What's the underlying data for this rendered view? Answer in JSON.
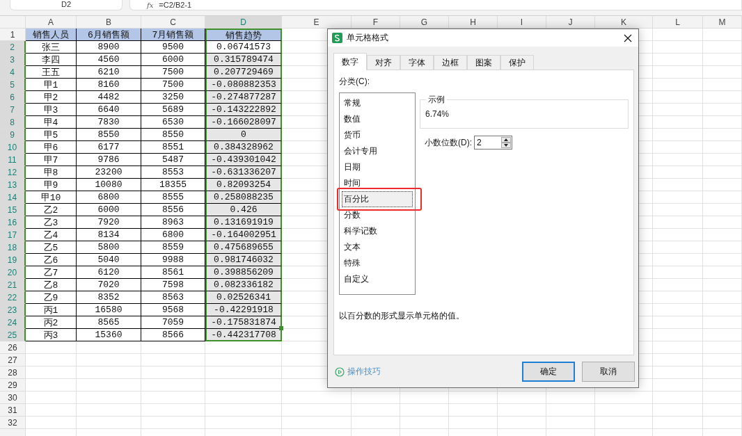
{
  "formula_bar": {
    "cell_name": "D2",
    "function_symbol": "fx",
    "formula": "=C2/B2-1"
  },
  "columns": [
    {
      "label": "A",
      "selected": false
    },
    {
      "label": "B",
      "selected": false
    },
    {
      "label": "C",
      "selected": false
    },
    {
      "label": "D",
      "selected": true
    },
    {
      "label": "E",
      "selected": false
    },
    {
      "label": "F",
      "selected": false
    },
    {
      "label": "G",
      "selected": false
    },
    {
      "label": "H",
      "selected": false
    },
    {
      "label": "I",
      "selected": false
    },
    {
      "label": "J",
      "selected": false
    },
    {
      "label": "K",
      "selected": false
    },
    {
      "label": "L",
      "selected": false
    },
    {
      "label": "M",
      "selected": false
    }
  ],
  "rows": [
    {
      "number": "1",
      "kind": "header",
      "selected": false,
      "active": false,
      "cells": [
        "销售人员",
        "6月销售额",
        "7月销售额",
        "销售趋势"
      ]
    },
    {
      "number": "2",
      "kind": "data",
      "selected": true,
      "active": true,
      "cells": [
        "张三",
        "8900",
        "9500",
        "0.06741573"
      ]
    },
    {
      "number": "3",
      "kind": "data",
      "selected": true,
      "active": false,
      "cells": [
        "李四",
        "4560",
        "6000",
        "0.315789474"
      ]
    },
    {
      "number": "4",
      "kind": "data",
      "selected": true,
      "active": false,
      "cells": [
        "王五",
        "6210",
        "7500",
        "0.207729469"
      ]
    },
    {
      "number": "5",
      "kind": "data",
      "selected": true,
      "active": false,
      "cells": [
        "甲1",
        "8160",
        "7500",
        "-0.080882353"
      ]
    },
    {
      "number": "6",
      "kind": "data",
      "selected": true,
      "active": false,
      "cells": [
        "甲2",
        "4482",
        "3250",
        "-0.274877287"
      ]
    },
    {
      "number": "7",
      "kind": "data",
      "selected": true,
      "active": false,
      "cells": [
        "甲3",
        "6640",
        "5689",
        "-0.143222892"
      ]
    },
    {
      "number": "8",
      "kind": "data",
      "selected": true,
      "active": false,
      "cells": [
        "甲4",
        "7830",
        "6530",
        "-0.166028097"
      ]
    },
    {
      "number": "9",
      "kind": "data",
      "selected": true,
      "active": false,
      "cells": [
        "甲5",
        "8550",
        "8550",
        "0"
      ]
    },
    {
      "number": "10",
      "kind": "data",
      "selected": true,
      "active": false,
      "cells": [
        "甲6",
        "6177",
        "8551",
        "0.384328962"
      ]
    },
    {
      "number": "11",
      "kind": "data",
      "selected": true,
      "active": false,
      "cells": [
        "甲7",
        "9786",
        "5487",
        "-0.439301042"
      ]
    },
    {
      "number": "12",
      "kind": "data",
      "selected": true,
      "active": false,
      "cells": [
        "甲8",
        "23200",
        "8553",
        "-0.631336207"
      ]
    },
    {
      "number": "13",
      "kind": "data",
      "selected": true,
      "active": false,
      "cells": [
        "甲9",
        "10080",
        "18355",
        "0.82093254"
      ]
    },
    {
      "number": "14",
      "kind": "data",
      "selected": true,
      "active": false,
      "cells": [
        "甲10",
        "6800",
        "8555",
        "0.258088235"
      ]
    },
    {
      "number": "15",
      "kind": "data",
      "selected": true,
      "active": false,
      "cells": [
        "乙2",
        "6000",
        "8556",
        "0.426"
      ]
    },
    {
      "number": "16",
      "kind": "data",
      "selected": true,
      "active": false,
      "cells": [
        "乙3",
        "7920",
        "8963",
        "0.131691919"
      ]
    },
    {
      "number": "17",
      "kind": "data",
      "selected": true,
      "active": false,
      "cells": [
        "乙4",
        "8134",
        "6800",
        "-0.164002951"
      ]
    },
    {
      "number": "18",
      "kind": "data",
      "selected": true,
      "active": false,
      "cells": [
        "乙5",
        "5800",
        "8559",
        "0.475689655"
      ]
    },
    {
      "number": "19",
      "kind": "data",
      "selected": true,
      "active": false,
      "cells": [
        "乙6",
        "5040",
        "9988",
        "0.981746032"
      ]
    },
    {
      "number": "20",
      "kind": "data",
      "selected": true,
      "active": false,
      "cells": [
        "乙7",
        "6120",
        "8561",
        "0.398856209"
      ]
    },
    {
      "number": "21",
      "kind": "data",
      "selected": true,
      "active": false,
      "cells": [
        "乙8",
        "7020",
        "7598",
        "0.082336182"
      ]
    },
    {
      "number": "22",
      "kind": "data",
      "selected": true,
      "active": false,
      "cells": [
        "乙9",
        "8352",
        "8563",
        "0.02526341"
      ]
    },
    {
      "number": "23",
      "kind": "data",
      "selected": true,
      "active": false,
      "cells": [
        "丙1",
        "16580",
        "9568",
        "-0.42291918"
      ]
    },
    {
      "number": "24",
      "kind": "data",
      "selected": true,
      "active": false,
      "cells": [
        "丙2",
        "8565",
        "7059",
        "-0.175831874"
      ]
    },
    {
      "number": "25",
      "kind": "data",
      "selected": true,
      "active": false,
      "cells": [
        "丙3",
        "15360",
        "8566",
        "-0.442317708"
      ]
    }
  ],
  "blank_rows": [
    "26",
    "27",
    "28",
    "29",
    "30",
    "31",
    "32"
  ],
  "dialog": {
    "title": "单元格格式",
    "tabs": [
      {
        "label": "数字",
        "selected": true
      },
      {
        "label": "对齐",
        "selected": false
      },
      {
        "label": "字体",
        "selected": false
      },
      {
        "label": "边框",
        "selected": false
      },
      {
        "label": "图案",
        "selected": false
      },
      {
        "label": "保护",
        "selected": false
      }
    ],
    "category_label": "分类(C):",
    "categories": [
      {
        "label": "常规",
        "selected": false,
        "annotated": false
      },
      {
        "label": "数值",
        "selected": false,
        "annotated": false
      },
      {
        "label": "货币",
        "selected": false,
        "annotated": false
      },
      {
        "label": "会计专用",
        "selected": false,
        "annotated": false
      },
      {
        "label": "日期",
        "selected": false,
        "annotated": false
      },
      {
        "label": "时间",
        "selected": false,
        "annotated": false
      },
      {
        "label": "百分比",
        "selected": true,
        "annotated": true
      },
      {
        "label": "分数",
        "selected": false,
        "annotated": false
      },
      {
        "label": "科学记数",
        "selected": false,
        "annotated": false
      },
      {
        "label": "文本",
        "selected": false,
        "annotated": false
      },
      {
        "label": "特殊",
        "selected": false,
        "annotated": false
      },
      {
        "label": "自定义",
        "selected": false,
        "annotated": false
      }
    ],
    "sample": {
      "label": "示例",
      "value": "6.74%"
    },
    "decimal_places": {
      "label": "小数位数(D):",
      "value": "2"
    },
    "description": "以百分数的形式显示单元格的值。",
    "tips_link": "操作技巧",
    "buttons": [
      {
        "label": "确定",
        "kind": "primary"
      },
      {
        "label": "取消",
        "kind": "secondary"
      }
    ]
  }
}
